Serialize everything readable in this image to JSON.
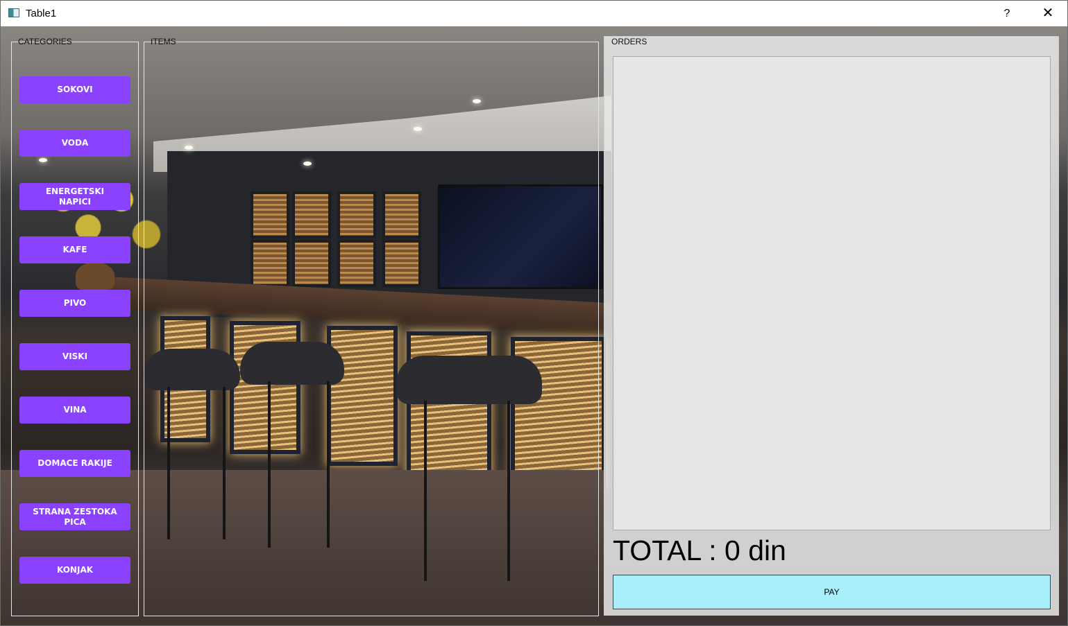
{
  "window": {
    "title": "Table1",
    "help_label": "?",
    "close_label": "✕"
  },
  "categories": {
    "title": "CATEGORIES",
    "accent_color": "#8a42ff",
    "items": [
      {
        "label": "SOKOVI"
      },
      {
        "label": "VODA"
      },
      {
        "label": "ENERGETSKI\nNAPICI"
      },
      {
        "label": "KAFE"
      },
      {
        "label": "PIVO"
      },
      {
        "label": "VISKI"
      },
      {
        "label": "VINA"
      },
      {
        "label": "DOMACE RAKIJE"
      },
      {
        "label": "STRANA ZESTOKA\nPICA"
      },
      {
        "label": "KONJAK"
      }
    ]
  },
  "items": {
    "title": "ITEMS"
  },
  "orders": {
    "title": "ORDERS",
    "total_label": "TOTAL : 0 din",
    "pay_label": "PAY",
    "pay_color": "#a8eefb"
  }
}
